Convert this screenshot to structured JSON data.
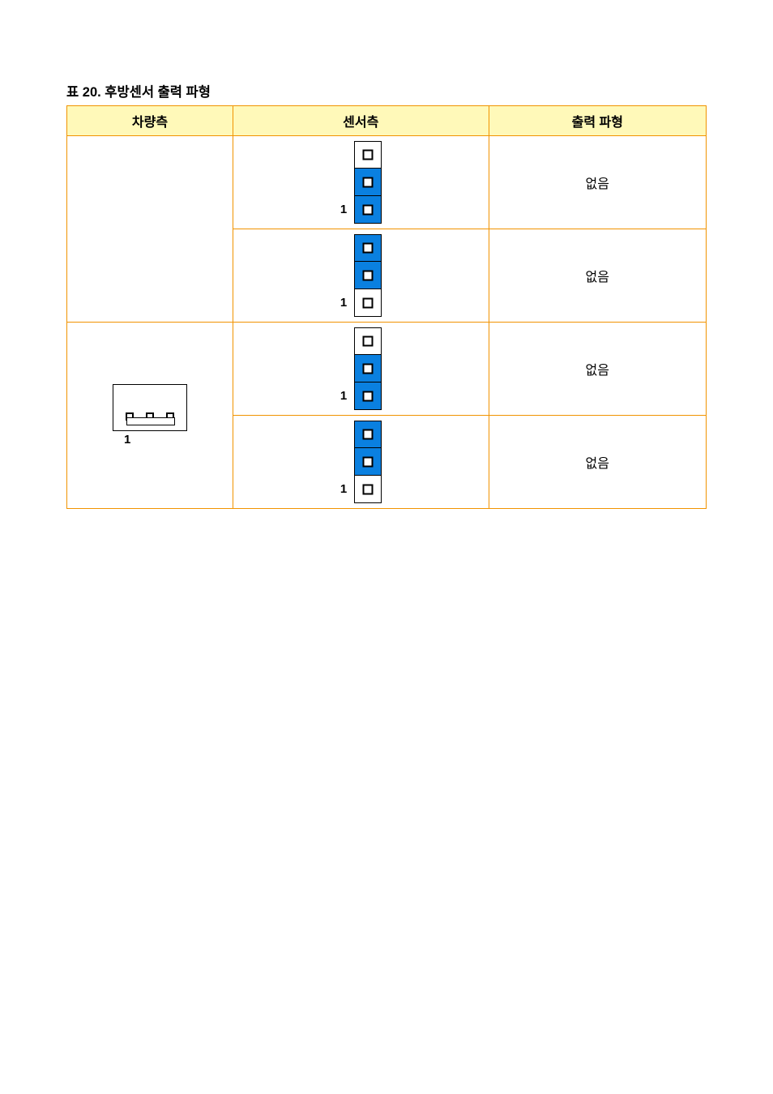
{
  "title": "표 20. 후방센서 출력 파형",
  "headers": {
    "c1": "차량측",
    "c2": "센서측",
    "c3": "출력 파형"
  },
  "rows": [
    {
      "vehicle": {
        "label": ""
      },
      "sensors": [
        {
          "block_num": "1",
          "blue": [
            false,
            true,
            true
          ]
        },
        {
          "block_num": "1",
          "blue": [
            true,
            true,
            false
          ]
        }
      ],
      "outputs": [
        "없음",
        "없음"
      ]
    },
    {
      "vehicle": {
        "connector_label": "1"
      },
      "sensors": [
        {
          "block_num": "1",
          "blue": [
            false,
            true,
            true
          ]
        },
        {
          "block_num": "1",
          "blue": [
            true,
            true,
            false
          ]
        }
      ],
      "outputs": [
        "없음",
        "없음"
      ]
    }
  ]
}
